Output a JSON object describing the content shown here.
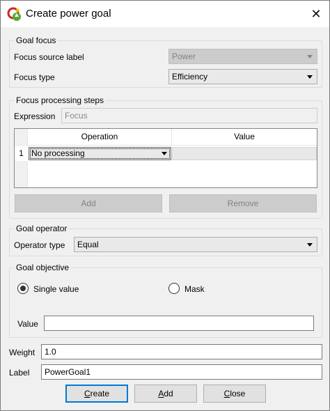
{
  "window": {
    "title": "Create power goal",
    "close_glyph": "✕",
    "app_icon": "power-app-icon"
  },
  "goal_focus": {
    "title": "Goal focus",
    "source_label": "Focus source label",
    "source_value": "Power",
    "type_label": "Focus type",
    "type_value": "Efficiency"
  },
  "processing": {
    "title": "Focus processing steps",
    "expression_label": "Expression",
    "expression_placeholder": "Focus",
    "columns": [
      "Operation",
      "Value"
    ],
    "rows": [
      {
        "num": "1",
        "operation": "No processing",
        "value": ""
      }
    ],
    "add_label": "Add",
    "remove_label": "Remove"
  },
  "goal_operator": {
    "title": "Goal operator",
    "type_label": "Operator type",
    "type_value": "Equal"
  },
  "goal_objective": {
    "title": "Goal objective",
    "single_value_label": "Single value",
    "mask_label": "Mask",
    "value_label": "Value",
    "value": ""
  },
  "weight": {
    "label": "Weight",
    "value": "1.0"
  },
  "label_field": {
    "label": "Label",
    "value": "PowerGoal1"
  },
  "buttons": {
    "create_label": "Create",
    "create_mnemonic": "C",
    "create_rest": "reate",
    "add_mnemonic": "A",
    "add_rest": "dd",
    "close_mnemonic": "C",
    "close_rest": "lose"
  }
}
